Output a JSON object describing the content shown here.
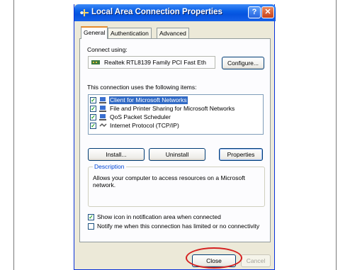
{
  "window": {
    "title": "Local Area Connection Properties",
    "help_glyph": "?",
    "close_glyph": "✕"
  },
  "tabs": [
    {
      "label": "General",
      "active": true
    },
    {
      "label": "Authentication",
      "active": false
    },
    {
      "label": "Advanced",
      "active": false
    }
  ],
  "general": {
    "connect_using_label": "Connect using:",
    "adapter_name": "Realtek RTL8139 Family PCI Fast Eth",
    "configure_button": "Configure...",
    "items_label": "This connection uses the following items:",
    "items": [
      {
        "label": "Client for Microsoft Networks",
        "checked": true,
        "selected": true,
        "icon": "network-client-icon"
      },
      {
        "label": "File and Printer Sharing for Microsoft Networks",
        "checked": true,
        "selected": false,
        "icon": "file-printer-sharing-icon"
      },
      {
        "label": "QoS Packet Scheduler",
        "checked": true,
        "selected": false,
        "icon": "qos-scheduler-icon"
      },
      {
        "label": "Internet Protocol (TCP/IP)",
        "checked": true,
        "selected": false,
        "icon": "tcpip-protocol-icon"
      }
    ],
    "install_button": "Install...",
    "uninstall_button": "Uninstall",
    "properties_button": "Properties",
    "description_title": "Description",
    "description_text": "Allows your computer to access resources on a Microsoft network.",
    "show_icon_label": "Show icon in notification area when connected",
    "show_icon_checked": true,
    "notify_label": "Notify me when this connection has limited or no connectivity",
    "notify_checked": false
  },
  "footer": {
    "close_button": "Close",
    "cancel_button": "Cancel"
  },
  "colors": {
    "titlebar": "#0553df",
    "selection": "#316ac5",
    "highlight_ellipse": "#d42020"
  }
}
